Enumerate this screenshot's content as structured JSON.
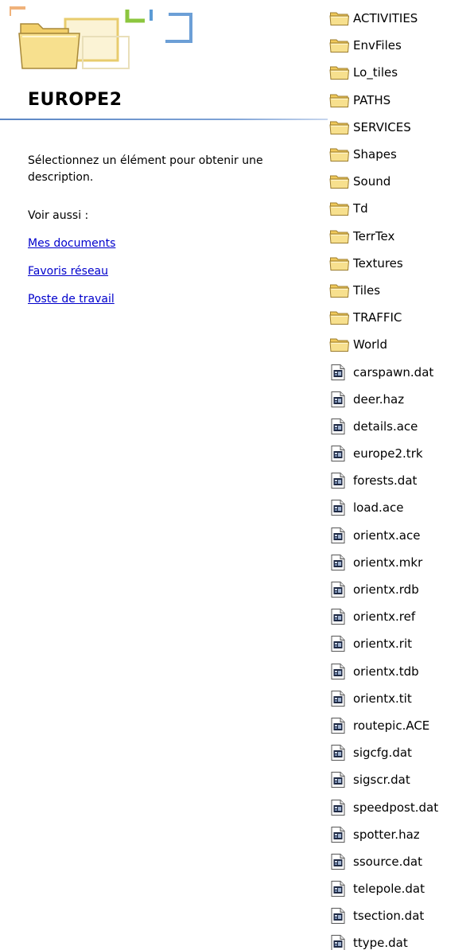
{
  "task_pane": {
    "title": "EUROPE2",
    "description": "Sélectionnez un élément pour obtenir une description.",
    "see_also_label": "Voir aussi :",
    "links": [
      "Mes documents",
      "Favoris réseau",
      "Poste de travail"
    ]
  },
  "colors": {
    "link": "#0000cc",
    "folder_fill": "#f5d982",
    "folder_outline": "#a8893a",
    "title_rule": "#5b86c4"
  },
  "file_list": {
    "items": [
      {
        "name": "ACTIVITIES",
        "icon": "folder-icon"
      },
      {
        "name": "EnvFiles",
        "icon": "folder-icon"
      },
      {
        "name": "Lo_tiles",
        "icon": "folder-icon"
      },
      {
        "name": "PATHS",
        "icon": "folder-icon"
      },
      {
        "name": "SERVICES",
        "icon": "folder-icon"
      },
      {
        "name": "Shapes",
        "icon": "folder-icon"
      },
      {
        "name": "Sound",
        "icon": "folder-icon"
      },
      {
        "name": "Td",
        "icon": "folder-icon"
      },
      {
        "name": "TerrTex",
        "icon": "folder-icon"
      },
      {
        "name": "Textures",
        "icon": "folder-icon"
      },
      {
        "name": "Tiles",
        "icon": "folder-icon"
      },
      {
        "name": "TRAFFIC",
        "icon": "folder-icon"
      },
      {
        "name": "World",
        "icon": "folder-icon"
      },
      {
        "name": "carspawn.dat",
        "icon": "file-icon"
      },
      {
        "name": "deer.haz",
        "icon": "file-icon"
      },
      {
        "name": "details.ace",
        "icon": "file-icon"
      },
      {
        "name": "europe2.trk",
        "icon": "file-icon"
      },
      {
        "name": "forests.dat",
        "icon": "file-icon"
      },
      {
        "name": "load.ace",
        "icon": "file-icon"
      },
      {
        "name": "orientx.ace",
        "icon": "file-icon"
      },
      {
        "name": "orientx.mkr",
        "icon": "file-icon"
      },
      {
        "name": "orientx.rdb",
        "icon": "file-icon"
      },
      {
        "name": "orientx.ref",
        "icon": "file-icon"
      },
      {
        "name": "orientx.rit",
        "icon": "file-icon"
      },
      {
        "name": "orientx.tdb",
        "icon": "file-icon"
      },
      {
        "name": "orientx.tit",
        "icon": "file-icon"
      },
      {
        "name": "routepic.ACE",
        "icon": "file-icon"
      },
      {
        "name": "sigcfg.dat",
        "icon": "file-icon"
      },
      {
        "name": "sigscr.dat",
        "icon": "file-icon"
      },
      {
        "name": "speedpost.dat",
        "icon": "file-icon"
      },
      {
        "name": "spotter.haz",
        "icon": "file-icon"
      },
      {
        "name": "ssource.dat",
        "icon": "file-icon"
      },
      {
        "name": "telepole.dat",
        "icon": "file-icon"
      },
      {
        "name": "tsection.dat",
        "icon": "file-icon"
      },
      {
        "name": "ttype.dat",
        "icon": "file-icon"
      }
    ]
  }
}
